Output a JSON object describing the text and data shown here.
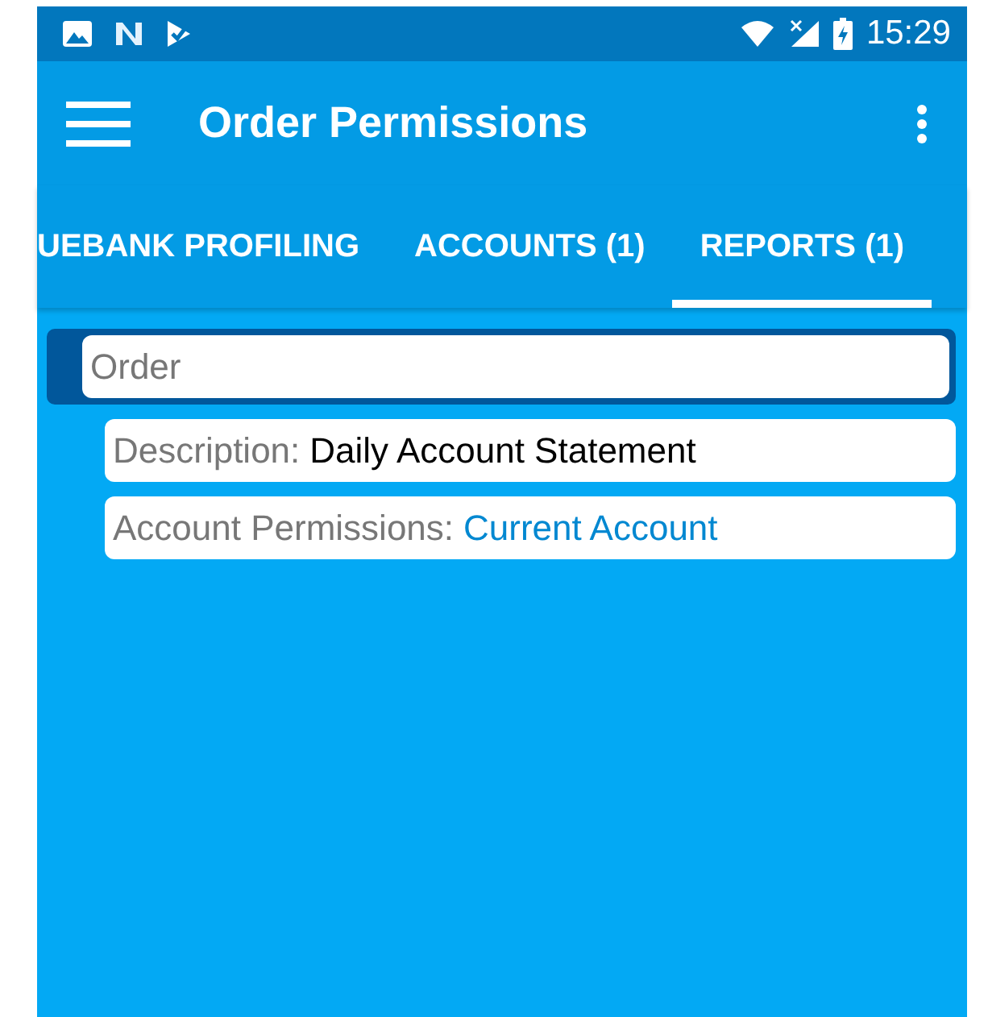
{
  "status_bar": {
    "time": "15:29"
  },
  "app_bar": {
    "title": "Order Permissions"
  },
  "tabs": [
    {
      "label": "UEBANK PROFILING",
      "selected": false
    },
    {
      "label": "ACCOUNTS (1)",
      "selected": false
    },
    {
      "label": "REPORTS (1)",
      "selected": true
    }
  ],
  "group": {
    "title": "Order",
    "expanded": true,
    "children": [
      {
        "label": "Description:",
        "value": "Daily Account Statement",
        "kind": "text"
      },
      {
        "label": "Account Permissions:",
        "value": "Current Account",
        "kind": "link"
      }
    ]
  }
}
